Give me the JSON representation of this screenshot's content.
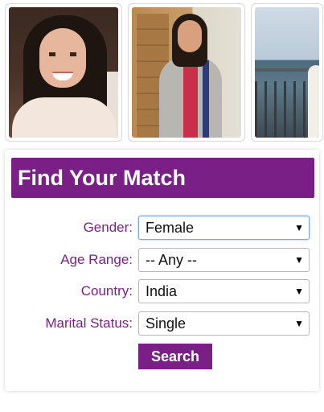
{
  "photos": [
    {
      "alt_name": "profile-photo-1"
    },
    {
      "alt_name": "profile-photo-2"
    },
    {
      "alt_name": "profile-photo-3"
    }
  ],
  "search": {
    "title": "Find Your Match",
    "fields": [
      {
        "label": "Gender:",
        "value": "Female"
      },
      {
        "label": "Age Range:",
        "value": "-- Any --"
      },
      {
        "label": "Country:",
        "value": "India"
      },
      {
        "label": "Marital Status:",
        "value": "Single"
      }
    ],
    "button_label": "Search",
    "dropdown_arrow": "▼"
  },
  "colors": {
    "brand": "#7a1f86",
    "focus": "#7aa7e6"
  }
}
